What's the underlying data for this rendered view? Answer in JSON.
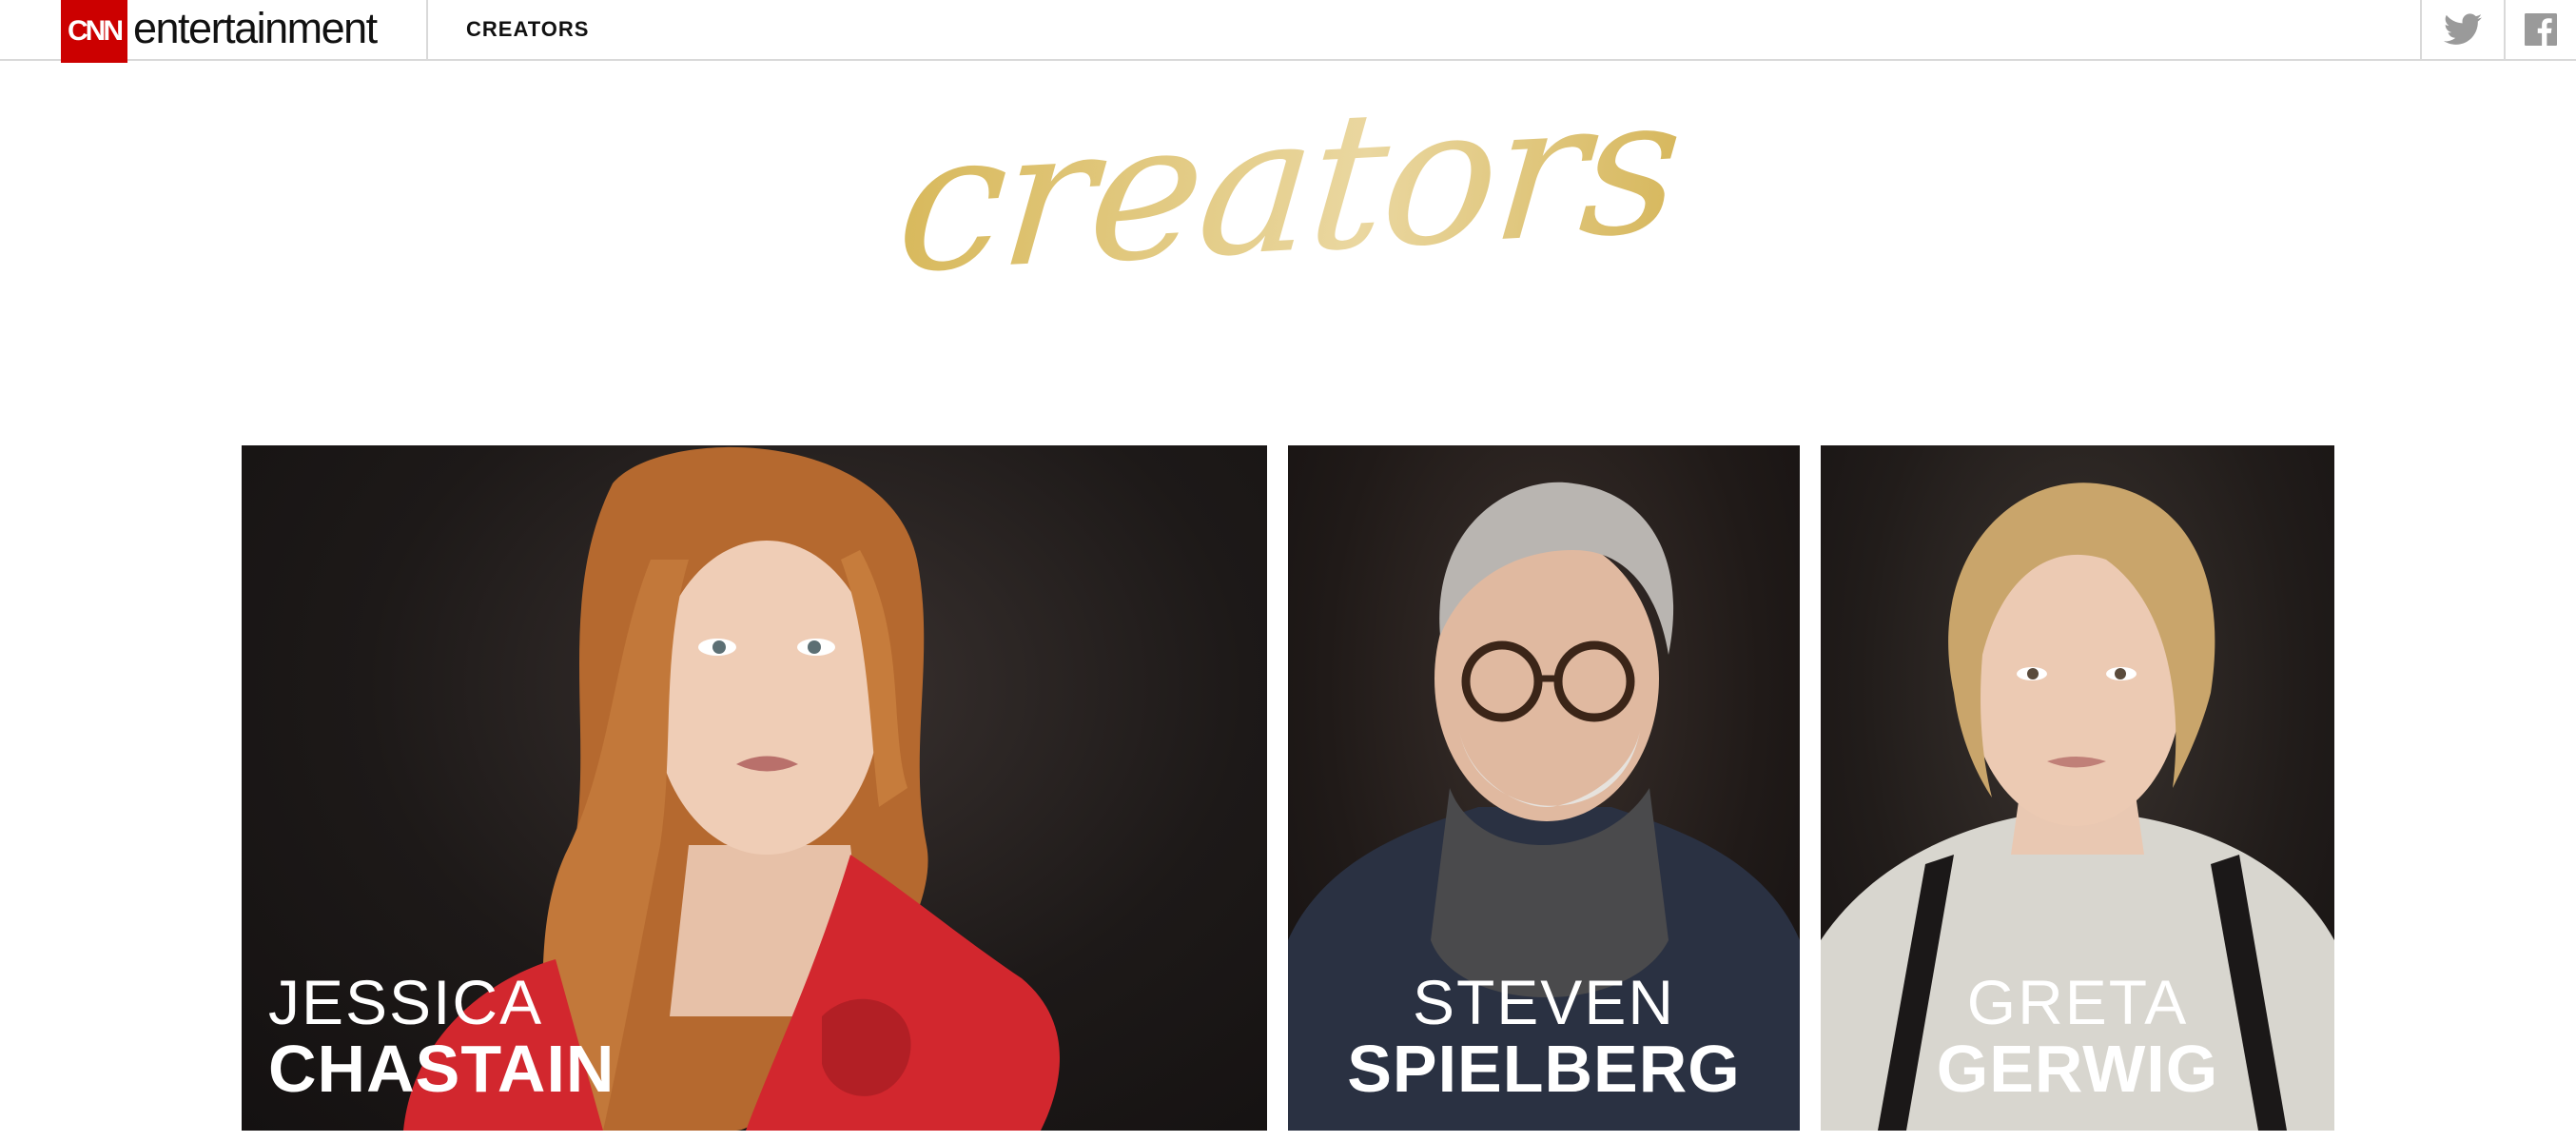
{
  "header": {
    "brand_logo": "CNN",
    "brand_word": "entertainment",
    "section_label": "CREATORS",
    "social": [
      {
        "name": "twitter",
        "icon": "twitter-icon"
      },
      {
        "name": "facebook",
        "icon": "facebook-icon"
      }
    ]
  },
  "hero": {
    "title": "creators",
    "title_color": "#e2c66d"
  },
  "cards": [
    {
      "first": "JESSICA",
      "last": "CHASTAIN",
      "accent": "#d2272e"
    },
    {
      "first": "STEVEN",
      "last": "SPIELBERG",
      "accent": "#2a3142"
    },
    {
      "first": "GRETA",
      "last": "GERWIG",
      "accent": "#d8d6cf"
    }
  ],
  "colors": {
    "cnn_red": "#cc0000",
    "gold": "#e2c66d",
    "card_bg": "#1b1716"
  }
}
